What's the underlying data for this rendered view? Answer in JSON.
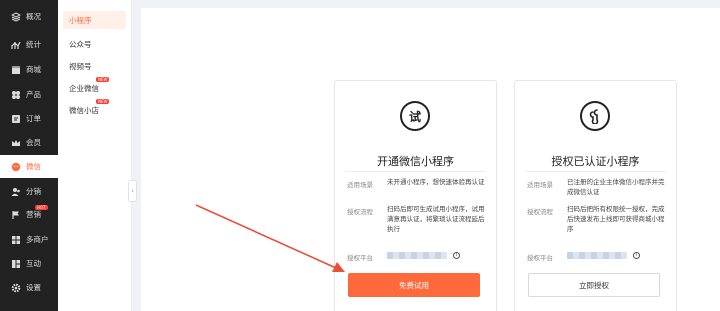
{
  "sidebar": {
    "items": [
      {
        "label": "概况",
        "icon": "layers-icon"
      },
      {
        "label": "统计",
        "icon": "chart-icon"
      },
      {
        "label": "商城",
        "icon": "shop-icon"
      },
      {
        "label": "产品",
        "icon": "grid-icon"
      },
      {
        "label": "订单",
        "icon": "order-icon"
      },
      {
        "label": "会员",
        "icon": "crown-icon"
      },
      {
        "label": "微信",
        "icon": "wechat-icon"
      },
      {
        "label": "分销",
        "icon": "users-icon"
      },
      {
        "label": "营销",
        "icon": "flag-icon",
        "badge": "HOT"
      },
      {
        "label": "多商户",
        "icon": "store-icon"
      },
      {
        "label": "互动",
        "icon": "interact-icon"
      },
      {
        "label": "设置",
        "icon": "gear-icon"
      }
    ],
    "active_color": "#ff6a3d"
  },
  "submenu": {
    "items": [
      {
        "label": "小程序"
      },
      {
        "label": "公众号"
      },
      {
        "label": "视频号"
      },
      {
        "label": "企业微信",
        "badge": "NEW"
      },
      {
        "label": "微信小店",
        "badge": "NEW"
      }
    ]
  },
  "cards": {
    "trial": {
      "icon_char": "试",
      "title": "开通微信小程序",
      "scene_label": "适用场景",
      "scene_text": "未开通小程序，想快速体验再认证",
      "flow_label": "授权流程",
      "flow_text": "扫码后即可生成试用小程序，试用满意再认证，将繁琐认证流程延后执行",
      "platform_label": "授权平台",
      "button": "免费试用"
    },
    "auth": {
      "title": "授权已认证小程序",
      "scene_label": "适用场景",
      "scene_text": "已注册的企业主体微信小程序并完成微信认证",
      "flow_label": "授权流程",
      "flow_text": "扫码后把所有权限统一授权，完成后快速发布上线即可获得商城小程序",
      "platform_label": "授权平台",
      "button": "立即授权"
    }
  },
  "colors": {
    "accent": "#ff6a3d",
    "arrow": "#e8503a"
  }
}
